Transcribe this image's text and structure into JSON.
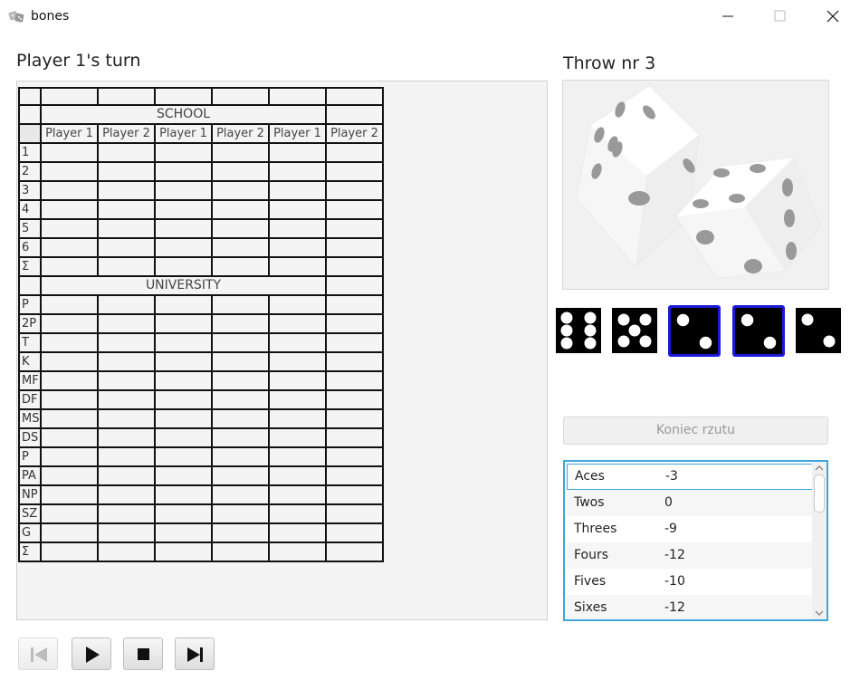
{
  "window": {
    "title": "bones",
    "app_icon": "dice-icon",
    "controls": [
      "minimize-icon",
      "maximize-icon",
      "close-icon"
    ]
  },
  "turn_label": "Player 1's turn",
  "throw_label": "Throw nr 3",
  "score_sheet": {
    "section_school": "SCHOOL",
    "section_university": "UNIVERSITY",
    "columns": [
      "Player 1",
      "Player 2",
      "Player 1",
      "Player 2",
      "Player 1",
      "Player 2"
    ],
    "school_rows": [
      "1",
      "2",
      "3",
      "4",
      "5",
      "6",
      "Σ"
    ],
    "university_rows": [
      "P",
      "2P",
      "T",
      "K",
      "MF",
      "DF",
      "MS",
      "DS",
      "P",
      "PA",
      "NP",
      "SZ",
      "G",
      "Σ"
    ]
  },
  "dice_image": "two-dice-image",
  "dice": [
    {
      "value": 6,
      "selected": false
    },
    {
      "value": 5,
      "selected": false
    },
    {
      "value": 2,
      "selected": true
    },
    {
      "value": 2,
      "selected": true
    },
    {
      "value": 2,
      "selected": false
    }
  ],
  "end_throw_button": "Koniec rzutu",
  "score_options": [
    {
      "name": "Aces",
      "value": "-3"
    },
    {
      "name": "Twos",
      "value": "0"
    },
    {
      "name": "Threes",
      "value": "-9"
    },
    {
      "name": "Fours",
      "value": "-12"
    },
    {
      "name": "Fives",
      "value": "-10"
    },
    {
      "name": "Sixes",
      "value": "-12"
    }
  ],
  "playback_controls": [
    "skip-back-icon",
    "play-icon",
    "stop-icon",
    "skip-forward-icon"
  ],
  "colors": {
    "selection_border": "#1a1ad8",
    "list_focus": "#3ea6d8"
  }
}
